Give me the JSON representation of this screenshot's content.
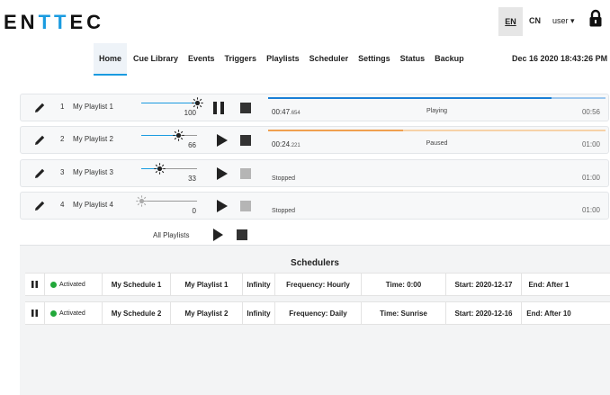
{
  "brand": {
    "logo_prefix": "EN",
    "logo_t1": "T",
    "logo_t2": "T",
    "logo_suffix": "EC",
    "accent": "#1a9be0"
  },
  "header": {
    "lang_en": "EN",
    "lang_cn": "CN",
    "user_menu": "user ▾",
    "lock_icon": "lock-icon"
  },
  "nav": {
    "items": [
      "Home",
      "Cue Library",
      "Events",
      "Triggers",
      "Playlists",
      "Scheduler",
      "Settings",
      "Status",
      "Backup"
    ],
    "active": "Home"
  },
  "datetime": "Dec 16 2020 18:43:26 PM",
  "playlists": [
    {
      "num": "1",
      "name": "My Playlist 1",
      "level": "100",
      "state": "playing",
      "elapsed_main": "00:47",
      "elapsed_frac": ".654",
      "status": "Playing",
      "duration": "00:56",
      "progress": 0.84,
      "color": "#1a7fd6",
      "track_color": "#9fc8ee"
    },
    {
      "num": "2",
      "name": "My Playlist 2",
      "level": "66",
      "state": "paused",
      "elapsed_main": "00:24",
      "elapsed_frac": ".221",
      "status": "Paused",
      "duration": "01:00",
      "progress": 0.4,
      "color": "#f0a050",
      "track_color": "#f6d2a8"
    },
    {
      "num": "3",
      "name": "My Playlist 3",
      "level": "33",
      "state": "stopped",
      "stopped_label": "Stopped",
      "duration": "01:00"
    },
    {
      "num": "4",
      "name": "My Playlist 4",
      "level": "0",
      "state": "stopped",
      "stopped_label": "Stopped",
      "duration": "01:00"
    }
  ],
  "all_playlists_label": "All Playlists",
  "schedulers": {
    "title": "Schedulers",
    "rows": [
      {
        "status": "Activated",
        "status_color": "#22a83a",
        "name": "My Schedule 1",
        "playlist": "My Playlist 1",
        "repeat": "Infinity",
        "frequency": "Frequency: Hourly",
        "time": "Time: 0:00",
        "start": "Start: 2020-12-17",
        "end": "End: After 1"
      },
      {
        "status": "Activated",
        "status_color": "#22a83a",
        "name": "My Schedule 2",
        "playlist": "My Playlist 2",
        "repeat": "Infinity",
        "frequency": "Frequency: Daily",
        "time": "Time: Sunrise",
        "start": "Start: 2020-12-16",
        "end": "End: After 10"
      }
    ]
  }
}
